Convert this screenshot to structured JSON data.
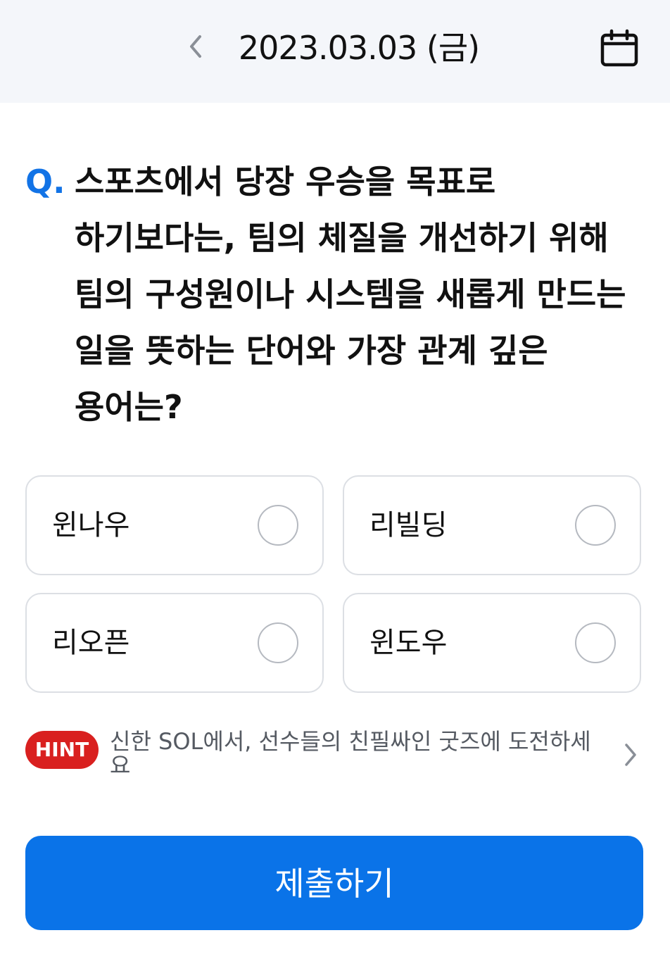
{
  "header": {
    "date": "2023.03.03 (금)",
    "back_icon": "chevron-left-icon",
    "calendar_icon": "calendar-icon"
  },
  "question": {
    "prefix": "Q.",
    "text": "스포츠에서 당장 우승을 목표로 하기보다는, 팀의 체질을 개선하기 위해 팀의 구성원이나 시스템을 새롭게 만드는 일을 뜻하는 단어와 가장 관계 깊은 용어는?"
  },
  "options": [
    {
      "label": "윈나우",
      "selected": false
    },
    {
      "label": "리빌딩",
      "selected": false
    },
    {
      "label": "리오픈",
      "selected": false
    },
    {
      "label": "윈도우",
      "selected": false
    }
  ],
  "hint": {
    "badge": "HINT",
    "text": "신한 SOL에서, 선수들의 친필싸인 굿즈에 도전하세요",
    "arrow_icon": "chevron-right-icon"
  },
  "submit": {
    "label": "제출하기"
  },
  "colors": {
    "accent": "#0a73e8",
    "question_mark": "#1273e6",
    "hint_badge": "#d9201f",
    "header_bg": "#f4f6fa"
  }
}
